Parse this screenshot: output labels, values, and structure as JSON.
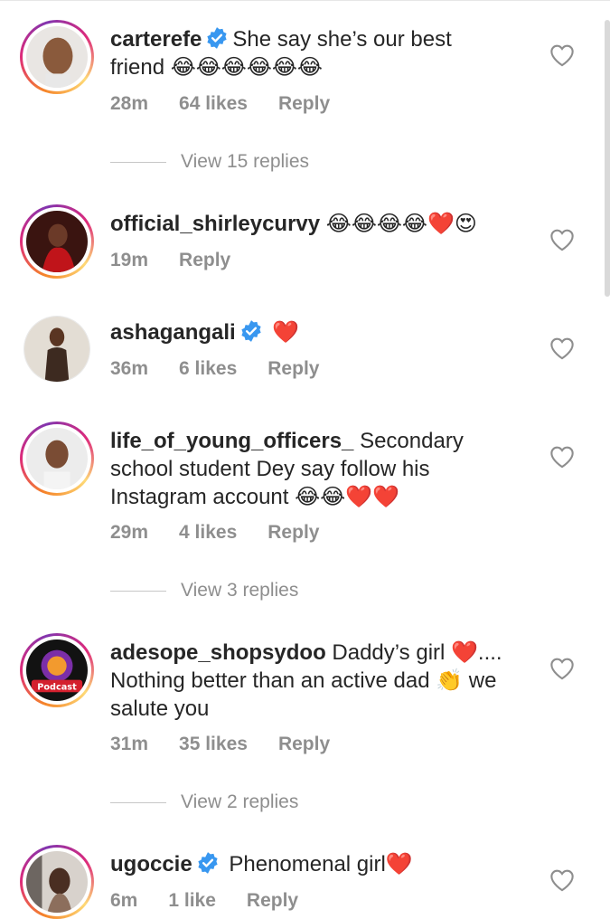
{
  "comments": [
    {
      "username": "carterefe",
      "verified": true,
      "text": "She say she’s our best friend 😂😂😂😂😂😂",
      "time": "28m",
      "likes": "64 likes",
      "reply": "Reply",
      "view_replies": "View 15 replies"
    },
    {
      "username": "official_shirleycurvy",
      "verified": false,
      "text": "😂😂😂😂❤️😍",
      "time": "19m",
      "likes": "",
      "reply": "Reply"
    },
    {
      "username": "ashagangali",
      "verified": true,
      "text": "❤️",
      "time": "36m",
      "likes": "6 likes",
      "reply": "Reply"
    },
    {
      "username": "life_of_young_officers_",
      "verified": false,
      "text": "Secondary school student Dey say follow his Instagram account 😂😂❤️❤️",
      "time": "29m",
      "likes": "4 likes",
      "reply": "Reply",
      "view_replies": "View 3 replies"
    },
    {
      "username": "adesope_shopsydoo",
      "verified": false,
      "text": "Daddy’s girl ❤️.... Nothing better than an active dad 👏 we salute you",
      "time": "31m",
      "likes": "35 likes",
      "reply": "Reply",
      "view_replies": "View 2 replies",
      "avatar_label": "Podcast"
    },
    {
      "username": "ugoccie",
      "verified": true,
      "text": "Phenomenal girl❤️",
      "time": "6m",
      "likes": "1 like",
      "reply": "Reply"
    }
  ],
  "colors": {
    "text": "#262626",
    "meta": "#8e8e8e",
    "verified": "#3897f0",
    "ring_start": "#f58529",
    "ring_end": "#dd2a7b"
  }
}
